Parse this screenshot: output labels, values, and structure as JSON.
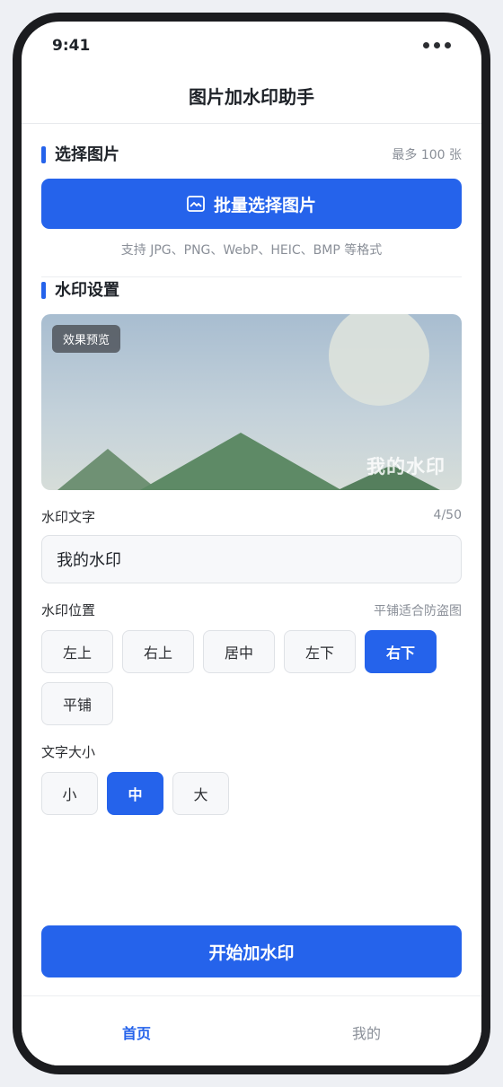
{
  "status_bar": {
    "time": "9:41"
  },
  "nav": {
    "title": "图片加水印助手"
  },
  "select_section": {
    "title": "选择图片",
    "limit_note": "最多 100 张",
    "button_label": "批量选择图片",
    "format_hint": "支持 JPG、PNG、WebP、HEIC、BMP 等格式"
  },
  "watermark_section": {
    "title": "水印设置",
    "preview_badge": "效果预览",
    "preview_watermark": "我的水印"
  },
  "text_field": {
    "label": "水印文字",
    "counter": "4/50",
    "value": "我的水印"
  },
  "position_field": {
    "label": "水印位置",
    "note": "平铺适合防盗图",
    "options": [
      "左上",
      "右上",
      "居中",
      "左下",
      "右下",
      "平铺"
    ],
    "selected": "右下"
  },
  "size_field": {
    "label": "文字大小",
    "options": [
      "小",
      "中",
      "大"
    ],
    "selected": "中"
  },
  "start_button": {
    "label": "开始加水印"
  },
  "tab_bar": {
    "items": [
      {
        "label": "首页",
        "active": true
      },
      {
        "label": "我的",
        "active": false
      }
    ]
  },
  "colors": {
    "accent": "#2563eb",
    "frame": "#1b1c1f",
    "mountain": "#5e8a66"
  }
}
